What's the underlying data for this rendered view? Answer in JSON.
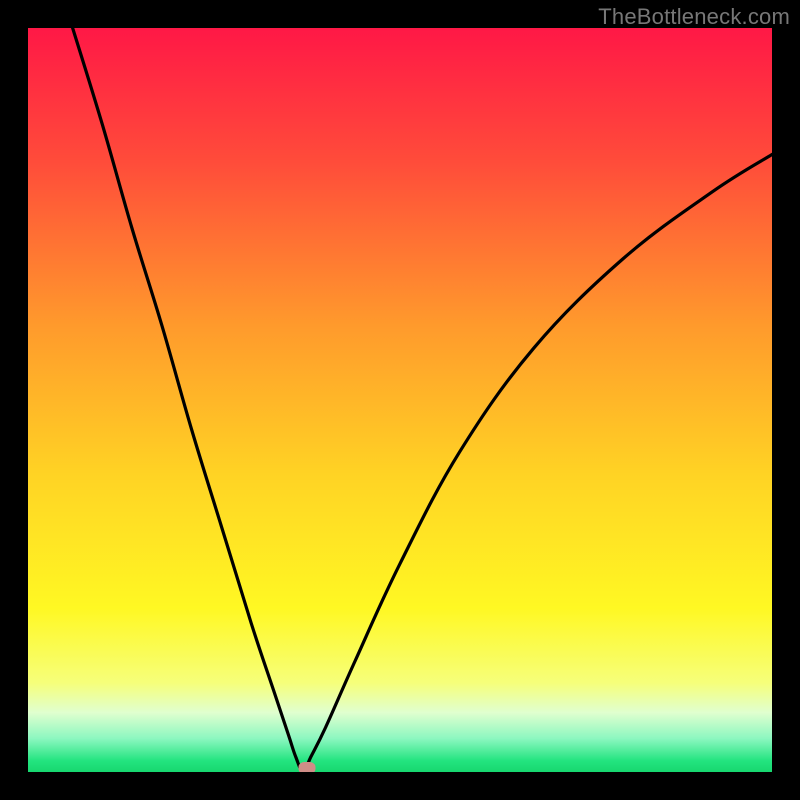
{
  "watermark": "TheBottleneck.com",
  "chart_data": {
    "type": "line",
    "title": "",
    "xlabel": "",
    "ylabel": "",
    "xlim": [
      0,
      100
    ],
    "ylim": [
      0,
      100
    ],
    "grid": false,
    "legend": false,
    "comment": "Bottleneck-style V-curve. Axis labels and numeric tick marks are not rendered in the source image, so values below are geometric estimates read off the plot area (0–100 normalized). Minimum (optimum) near x≈37.",
    "series": [
      {
        "name": "bottleneck-curve",
        "x": [
          6,
          10,
          14,
          18,
          22,
          26,
          30,
          33,
          35,
          36,
          37,
          38,
          40,
          44,
          50,
          58,
          68,
          80,
          92,
          100
        ],
        "y": [
          100,
          87,
          73,
          60,
          46,
          33,
          20,
          11,
          5,
          2,
          0,
          2,
          6,
          15,
          28,
          43,
          57,
          69,
          78,
          83
        ]
      }
    ],
    "marker": {
      "x": 37.5,
      "y": 0,
      "shape": "rounded-rect",
      "color": "#cf8d87"
    },
    "background_gradient": {
      "type": "vertical",
      "stops": [
        {
          "pos": 0.0,
          "color": "#ff1846"
        },
        {
          "pos": 0.18,
          "color": "#ff4c3a"
        },
        {
          "pos": 0.4,
          "color": "#ff9a2c"
        },
        {
          "pos": 0.6,
          "color": "#ffd324"
        },
        {
          "pos": 0.78,
          "color": "#fff823"
        },
        {
          "pos": 0.88,
          "color": "#f6ff7a"
        },
        {
          "pos": 0.92,
          "color": "#e0ffcf"
        },
        {
          "pos": 0.955,
          "color": "#8cf7c0"
        },
        {
          "pos": 0.985,
          "color": "#23e47f"
        },
        {
          "pos": 1.0,
          "color": "#17d76f"
        }
      ]
    }
  }
}
